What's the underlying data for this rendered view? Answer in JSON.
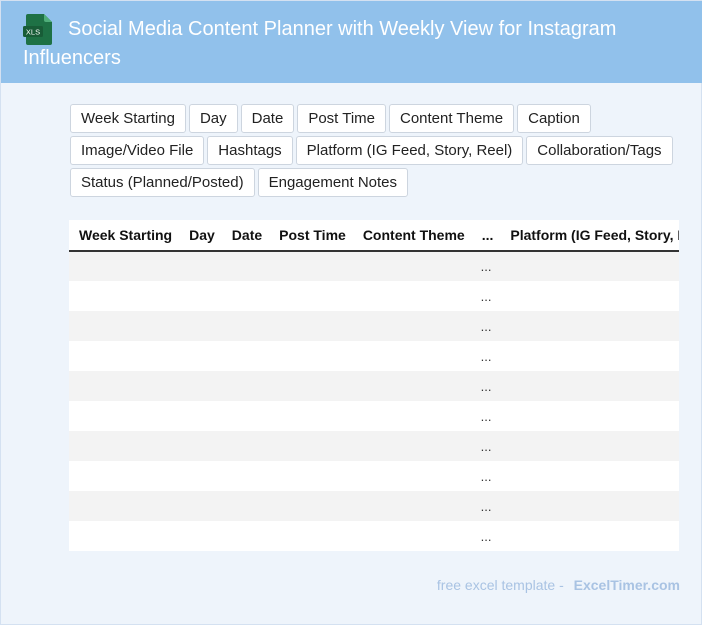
{
  "header": {
    "title": "Social Media Content Planner with Weekly View for Instagram Influencers",
    "icon_label": "XLS",
    "icon_color": "#1e7145"
  },
  "chips": [
    [
      "Week Starting",
      "Day",
      "Date",
      "Post Time",
      "Content Theme",
      "Caption"
    ],
    [
      "Image/Video File",
      "Hashtags",
      "Platform (IG Feed, Story, Reel)",
      "Collaboration/Tags"
    ],
    [
      "Status (Planned/Posted)",
      "Engagement Notes"
    ]
  ],
  "table": {
    "columns": [
      "Week Starting",
      "Day",
      "Date",
      "Post Time",
      "Content Theme",
      "...",
      "Platform (IG Feed, Story, Reel)"
    ],
    "ellipsis": "...",
    "row_count": 10
  },
  "footer": {
    "prefix": "free excel template -",
    "brand": "ExcelTimer.com"
  }
}
